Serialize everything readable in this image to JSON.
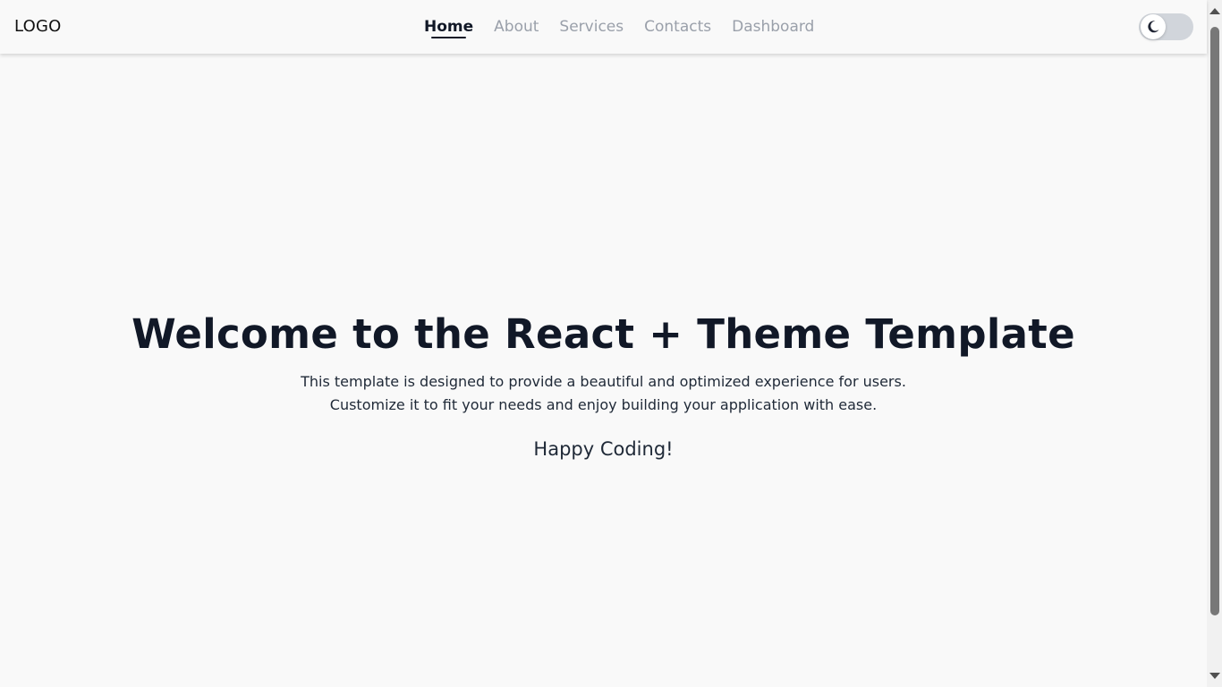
{
  "header": {
    "logo": "LOGO",
    "nav": [
      {
        "label": "Home",
        "active": true
      },
      {
        "label": "About",
        "active": false
      },
      {
        "label": "Services",
        "active": false
      },
      {
        "label": "Contacts",
        "active": false
      },
      {
        "label": "Dashboard",
        "active": false
      }
    ],
    "theme_toggle": {
      "icon": "moon-icon",
      "state": "light"
    }
  },
  "hero": {
    "title": "Welcome to the React + Theme Template",
    "description_line1": "This template is designed to provide a beautiful and optimized experience for users.",
    "description_line2": "Customize it to fit your needs and enjoy building your application with ease.",
    "tagline": "Happy Coding!"
  },
  "colors": {
    "background": "#f9f9f9",
    "text_primary": "#111827",
    "nav_inactive": "#9aa0aa",
    "toggle_track": "#d1d5db"
  }
}
